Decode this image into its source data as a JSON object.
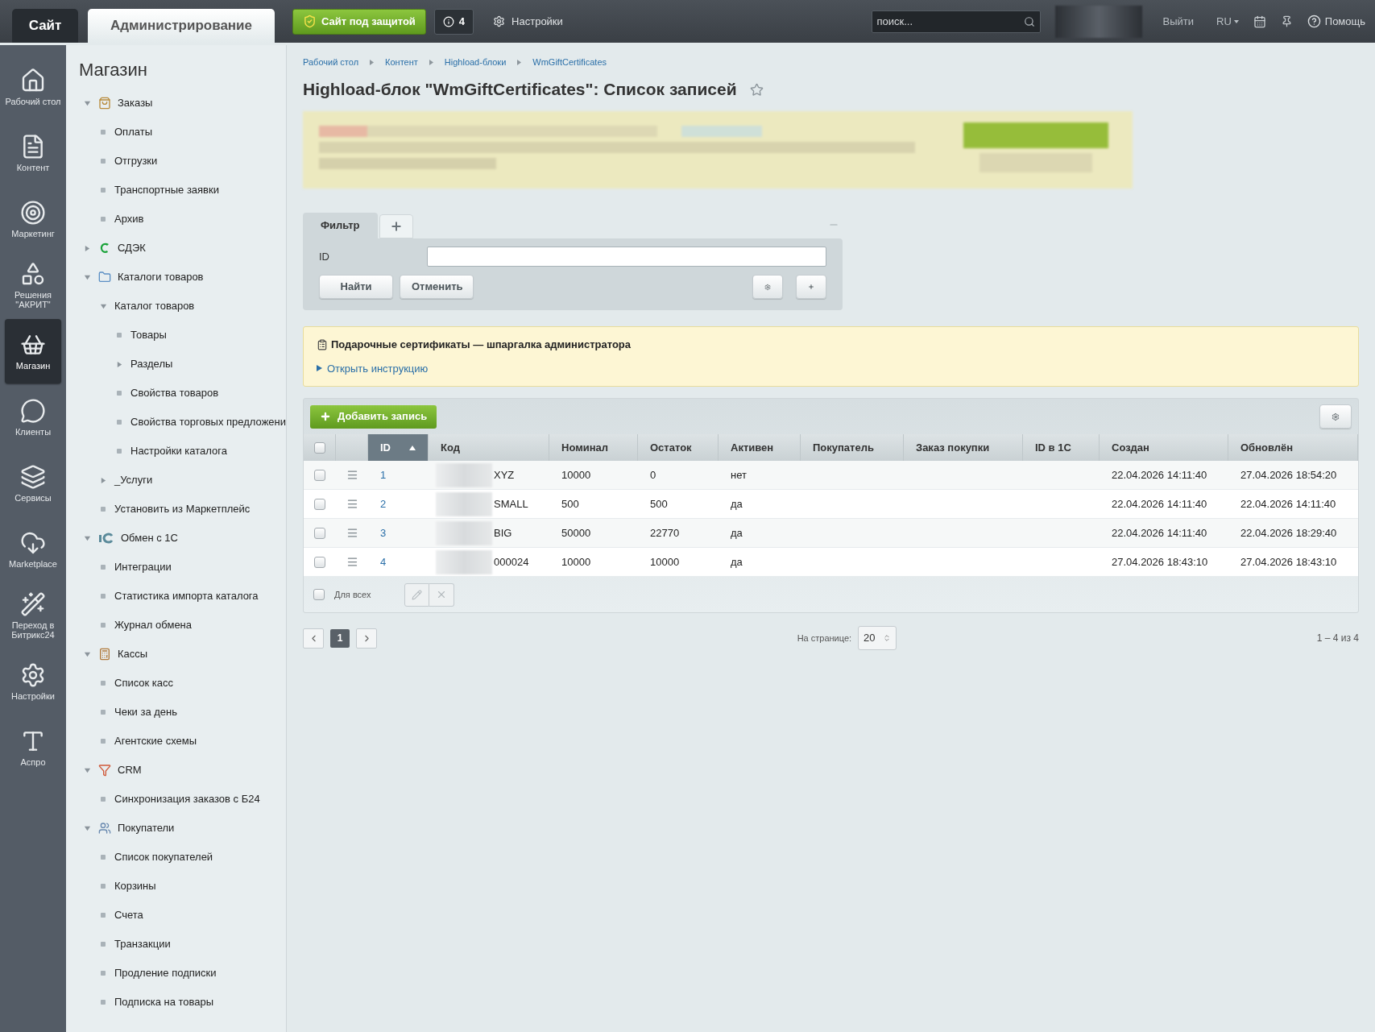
{
  "top_bar": {
    "site_tab": {
      "label": "Сайт",
      "selected": false
    },
    "admin_tab": {
      "label": "Администрирование",
      "selected": true
    },
    "protection_button": "Сайт под защитой",
    "notifications": "4",
    "settings": "Настройки",
    "search": {
      "placeholder": "поиск..."
    },
    "logout": "Выйти",
    "language": {
      "label": "RU",
      "expanded": false
    },
    "help": "Помощь"
  },
  "nav_bar": [
    {
      "label": "Рабочий стол",
      "selected": false
    },
    {
      "label": "Контент",
      "selected": false
    },
    {
      "label": "Маркетинг",
      "selected": false
    },
    {
      "label": "Решения \"АКРИТ\"",
      "selected": false
    },
    {
      "label": "Магазин",
      "selected": true
    },
    {
      "label": "Клиенты",
      "selected": false
    },
    {
      "label": "Сервисы",
      "selected": false
    },
    {
      "label": "Marketplace",
      "selected": false
    },
    {
      "label": "Переход в Битрикс24",
      "selected": false
    },
    {
      "label": "Настройки",
      "selected": false
    },
    {
      "label": "Аспро",
      "selected": false
    }
  ],
  "menu": {
    "title": "Магазин",
    "items": [
      {
        "label": "Заказы",
        "kind": "folder",
        "expanded": true,
        "children": [
          {
            "label": "Оплаты",
            "kind": "page"
          },
          {
            "label": "Отгрузки",
            "kind": "page"
          },
          {
            "label": "Транспортные заявки",
            "kind": "page"
          },
          {
            "label": "Архив",
            "kind": "page"
          }
        ]
      },
      {
        "label": "СДЭК",
        "kind": "folder",
        "expanded": false
      },
      {
        "label": "Каталоги товаров",
        "kind": "folder",
        "expanded": true,
        "children": [
          {
            "label": "Каталог товаров",
            "kind": "folder",
            "expanded": true,
            "children": [
              {
                "label": "Товары",
                "kind": "page"
              },
              {
                "label": "Разделы",
                "kind": "folder",
                "expanded": false
              },
              {
                "label": "Свойства товаров",
                "kind": "page"
              },
              {
                "label": "Свойства торговых предложени",
                "kind": "page"
              },
              {
                "label": "Настройки каталога",
                "kind": "page"
              }
            ]
          },
          {
            "label": "_Услуги",
            "kind": "folder",
            "expanded": false
          },
          {
            "label": "Установить из Маркетплейс",
            "kind": "page"
          }
        ]
      },
      {
        "label": "Обмен с 1С",
        "kind": "folder",
        "expanded": true,
        "children": [
          {
            "label": "Интеграции",
            "kind": "page"
          },
          {
            "label": "Статистика импорта каталога",
            "kind": "page"
          },
          {
            "label": "Журнал обмена",
            "kind": "page"
          }
        ]
      },
      {
        "label": "Кассы",
        "kind": "folder",
        "expanded": true,
        "children": [
          {
            "label": "Список касс",
            "kind": "page"
          },
          {
            "label": "Чеки за день",
            "kind": "page"
          },
          {
            "label": "Агентские схемы",
            "kind": "page"
          }
        ]
      },
      {
        "label": "CRM",
        "kind": "folder",
        "expanded": true,
        "children": [
          {
            "label": "Синхронизация заказов с Б24",
            "kind": "page"
          }
        ]
      },
      {
        "label": "Покупатели",
        "kind": "folder",
        "expanded": true,
        "children": [
          {
            "label": "Список покупателей",
            "kind": "page"
          },
          {
            "label": "Корзины",
            "kind": "page"
          },
          {
            "label": "Счета",
            "kind": "page"
          },
          {
            "label": "Транзакции",
            "kind": "page"
          },
          {
            "label": "Продление подписки",
            "kind": "page"
          },
          {
            "label": "Подписка на товары",
            "kind": "page"
          }
        ]
      }
    ]
  },
  "breadcrumbs": [
    "Рабочий стол",
    "Контент",
    "Highload-блоки",
    "WmGiftCertificates"
  ],
  "page_title": "Highload-блок \"WmGiftCertificates\": Список записей",
  "filter": {
    "tabs": [
      {
        "label": "Фильтр",
        "selected": true
      }
    ],
    "field_label": "ID",
    "buttons": [
      "Найти",
      "Отменить"
    ]
  },
  "notice": {
    "title": "Подарочные сертификаты — шпаргалка администратора",
    "link": "Открыть инструкцию"
  },
  "add_button": "Добавить запись",
  "table": {
    "header_checked": false,
    "columns": [
      {
        "label": "ID",
        "sorted": true
      },
      {
        "label": "Код",
        "sorted": false
      },
      {
        "label": "Номинал",
        "sorted": false
      },
      {
        "label": "Остаток",
        "sorted": false
      },
      {
        "label": "Активен",
        "sorted": false
      },
      {
        "label": "Покупатель",
        "sorted": false
      },
      {
        "label": "Заказ покупки",
        "sorted": false
      },
      {
        "label": "ID в 1С",
        "sorted": false
      },
      {
        "label": "Создан",
        "sorted": false
      },
      {
        "label": "Обновлён",
        "sorted": false
      }
    ],
    "rows": [
      {
        "checked": false,
        "id": "1",
        "code": "XYZ",
        "nominal": "10000",
        "remain": "0",
        "active": "нет",
        "created": "22.04.2026 14:11:40",
        "updated": "27.04.2026 18:54:20"
      },
      {
        "checked": false,
        "id": "2",
        "code": "SMALL",
        "nominal": "500",
        "remain": "500",
        "active": "да",
        "created": "22.04.2026 14:11:40",
        "updated": "22.04.2026 14:11:40"
      },
      {
        "checked": false,
        "id": "3",
        "code": "BIG",
        "nominal": "50000",
        "remain": "22770",
        "active": "да",
        "created": "22.04.2026 14:11:40",
        "updated": "22.04.2026 18:29:40"
      },
      {
        "checked": false,
        "id": "4",
        "code": "000024",
        "nominal": "10000",
        "remain": "10000",
        "active": "да",
        "created": "27.04.2026 18:43:10",
        "updated": "27.04.2026 18:43:10"
      }
    ],
    "footer": {
      "select_all_label": "Для всех",
      "checked": false
    }
  },
  "pagination": {
    "pages": [
      {
        "label": "1",
        "selected": true
      }
    ],
    "per_page_label": "На странице:",
    "per_page": "20",
    "summary": "1 – 4 из 4"
  }
}
